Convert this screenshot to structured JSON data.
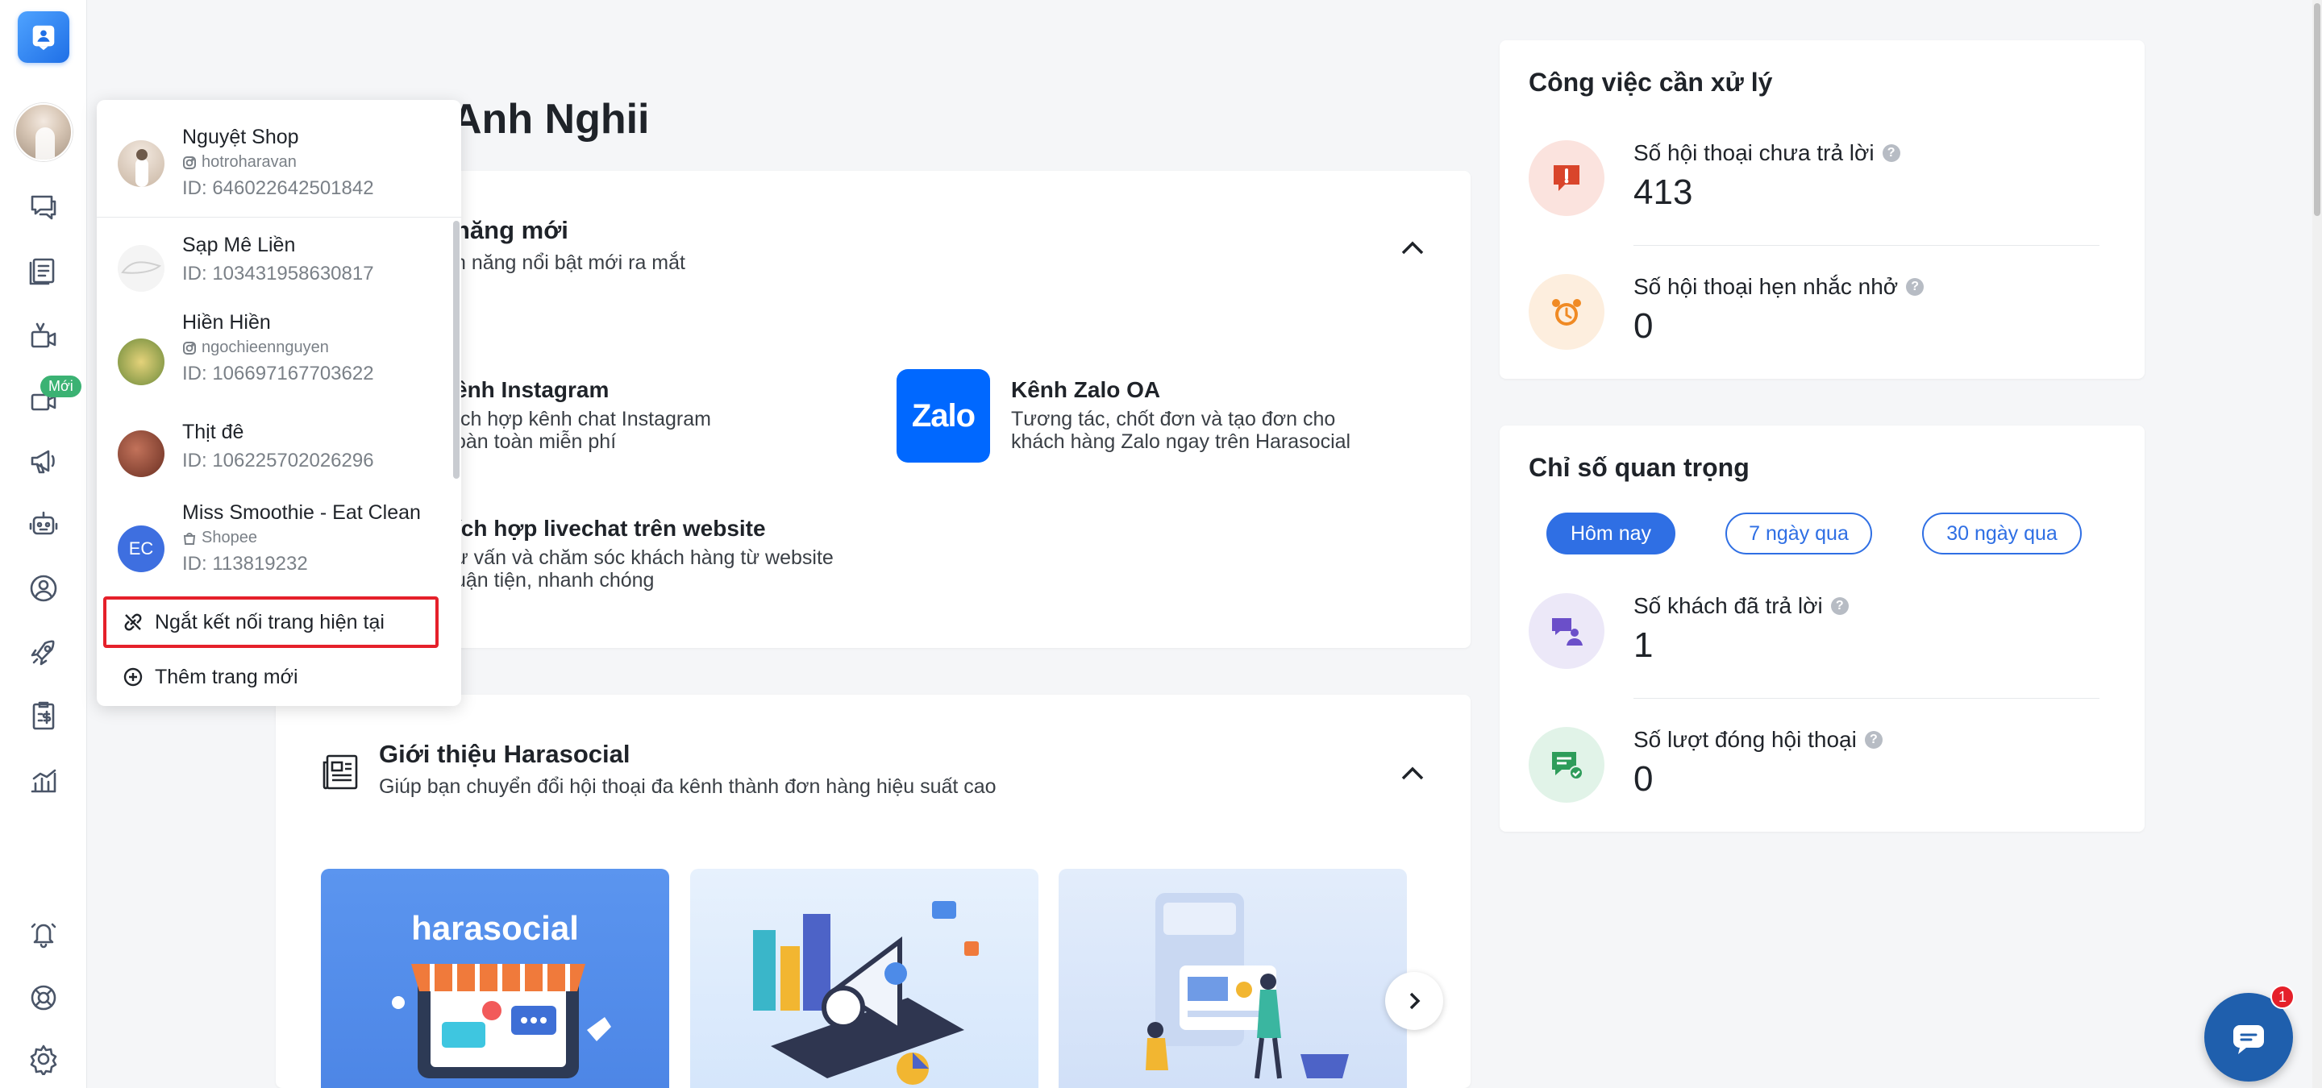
{
  "greeting": "Anh Nghii",
  "rail": {
    "new_badge": "Mới",
    "icons": [
      "app-logo-icon",
      "chat-icon",
      "orders-icon",
      "livestream-icon",
      "livestream-new-icon",
      "campaign-icon",
      "bot-icon",
      "customer-icon",
      "rocket-icon",
      "invoice-icon",
      "report-icon",
      "notification-icon",
      "support-icon",
      "settings-icon"
    ]
  },
  "page_switcher": {
    "selected": {
      "name": "Nguyệt Shop",
      "handle": "hotroharavan",
      "id": "ID: 646022642501842",
      "channel": "instagram"
    },
    "pages": [
      {
        "name": "Sạp Mê Liền",
        "handle": "",
        "id": "ID: 103431958630817",
        "channel": "facebook"
      },
      {
        "name": "Hiền Hiền",
        "handle": "ngochieennguyen",
        "id": "ID: 106697167703622",
        "channel": "instagram"
      },
      {
        "name": "Thịt đê",
        "handle": "",
        "id": "ID: 106225702026296",
        "channel": "facebook"
      },
      {
        "name": "Miss Smoothie - Eat Clean",
        "handle": "Shopee",
        "id": "ID: 113819232",
        "channel": "shopee",
        "initials": "EC"
      }
    ],
    "disconnect_label": "Ngắt kết nối trang hiện tại",
    "add_page_label": "Thêm trang mới"
  },
  "features": {
    "title": "năng mới",
    "subtitle": "h năng nổi bật mới ra mắt",
    "items": [
      {
        "title": "ênh Instagram",
        "desc1": "ích hợp kênh chat Instagram",
        "desc2": "oàn toàn miễn phí"
      },
      {
        "title": "Kênh Zalo OA",
        "desc1": "Tương tác, chốt đơn và tạo đơn cho",
        "desc2": "khách hàng Zalo ngay trên Harasocial",
        "logo_text": "Zalo"
      },
      {
        "title": "ích hợp livechat trên website",
        "desc1": "ư vấn và chăm sóc khách hàng từ website",
        "desc2": "uận tiện, nhanh chóng"
      }
    ]
  },
  "intro": {
    "title": "Giới thiệu Harasocial",
    "subtitle": "Giúp bạn chuyển đổi hội thoại đa kênh thành đơn hàng hiệu suất cao",
    "tile_logo": "harasocial"
  },
  "tasks": {
    "title": "Công việc cần xử lý",
    "metrics": [
      {
        "label": "Số hội thoại chưa trả lời",
        "value": "413",
        "icon": "unanswered-icon",
        "color": "#d9452b",
        "bg": "#fbe3de"
      },
      {
        "label": "Số hội thoại hẹn nhắc nhở",
        "value": "0",
        "icon": "alarm-icon",
        "color": "#f08a24",
        "bg": "#fdeede"
      }
    ]
  },
  "stats": {
    "title": "Chỉ số quan trọng",
    "ranges": [
      "Hôm nay",
      "7 ngày qua",
      "30 ngày qua"
    ],
    "active_range": "Hôm nay",
    "metrics": [
      {
        "label": "Số khách đã trả lời",
        "value": "1",
        "icon": "customer-replied-icon",
        "color": "#6b4fc9",
        "bg": "#ece8f8"
      },
      {
        "label": "Số lượt đóng hội thoại",
        "value": "0",
        "icon": "closed-conversation-icon",
        "color": "#2e9c5a",
        "bg": "#e1f3e8"
      }
    ]
  },
  "chat_badge": "1",
  "colors": {
    "primary": "#2f6fe4",
    "danger": "#e5202a",
    "zalo": "#0068ff"
  }
}
